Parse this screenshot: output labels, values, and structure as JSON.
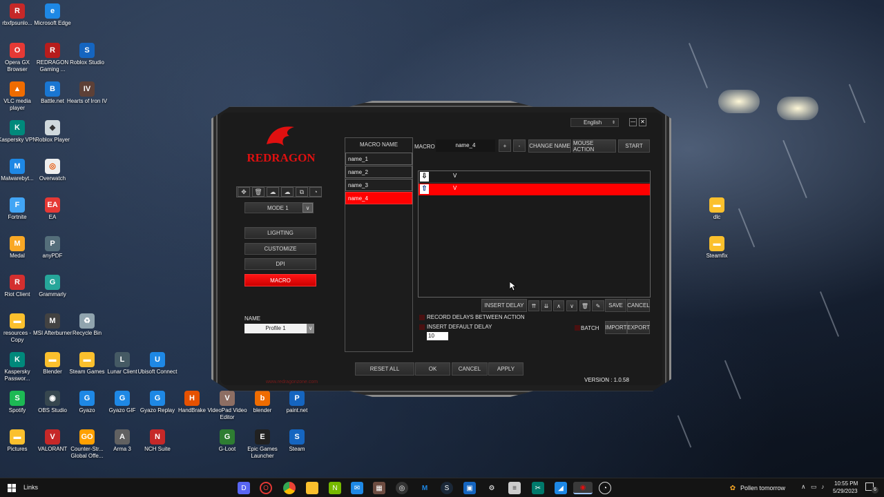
{
  "desktop": {
    "icons": [
      {
        "label": "rbxfpsunlo...",
        "color": "#c62828",
        "glyph": "R"
      },
      {
        "label": "Microsoft Edge",
        "color": "#1e88e5",
        "glyph": "e"
      },
      {
        "label": "Opera GX Browser",
        "color": "#e53935",
        "glyph": "O"
      },
      {
        "label": "REDRAGON Gaming ...",
        "color": "#b71c1c",
        "glyph": "R"
      },
      {
        "label": "Roblox Studio",
        "color": "#1565c0",
        "glyph": "S"
      },
      {
        "label": "VLC media player",
        "color": "#ef6c00",
        "glyph": "▲"
      },
      {
        "label": "Battle.net",
        "color": "#1976d2",
        "glyph": "B"
      },
      {
        "label": "Hearts of Iron IV",
        "color": "#5d4037",
        "glyph": "IV"
      },
      {
        "label": "Kaspersky VPN",
        "color": "#00897b",
        "glyph": "K"
      },
      {
        "label": "Roblox Player",
        "color": "#cfd8dc",
        "glyph": "◆"
      },
      {
        "label": "Malwarebyt...",
        "color": "#1e88e5",
        "glyph": "M"
      },
      {
        "label": "Overwatch",
        "color": "#eeeeee",
        "glyph": "◎"
      },
      {
        "label": "Fortnite",
        "color": "#42a5f5",
        "glyph": "F"
      },
      {
        "label": "EA",
        "color": "#e53935",
        "glyph": "EA"
      },
      {
        "label": "Medal",
        "color": "#f9a825",
        "glyph": "M"
      },
      {
        "label": "anyPDF",
        "color": "#546e7a",
        "glyph": "P"
      },
      {
        "label": "Riot Client",
        "color": "#d32f2f",
        "glyph": "R"
      },
      {
        "label": "Grammarly",
        "color": "#26a69a",
        "glyph": "G"
      },
      {
        "label": "resources - Copy",
        "color": "#fbc02d",
        "glyph": "▬"
      },
      {
        "label": "MSI Afterburner",
        "color": "#424242",
        "glyph": "M"
      },
      {
        "label": "Recycle Bin",
        "color": "#90a4ae",
        "glyph": "♻"
      },
      {
        "label": "Kaspersky Passwor...",
        "color": "#00897b",
        "glyph": "K"
      },
      {
        "label": "Blender",
        "color": "#fbc02d",
        "glyph": "▬"
      },
      {
        "label": "Steam Games",
        "color": "#fbc02d",
        "glyph": "▬"
      },
      {
        "label": "Lunar Client",
        "color": "#455a64",
        "glyph": "L"
      },
      {
        "label": "Ubisoft Connect",
        "color": "#1e88e5",
        "glyph": "U"
      },
      {
        "label": "Spotify",
        "color": "#1db954",
        "glyph": "S"
      },
      {
        "label": "OBS Studio",
        "color": "#37474f",
        "glyph": "◉"
      },
      {
        "label": "Gyazo",
        "color": "#1e88e5",
        "glyph": "G"
      },
      {
        "label": "Gyazo GIF",
        "color": "#1e88e5",
        "glyph": "G"
      },
      {
        "label": "Gyazo Replay",
        "color": "#1e88e5",
        "glyph": "G"
      },
      {
        "label": "HandBrake",
        "color": "#e65100",
        "glyph": "H"
      },
      {
        "label": "VideoPad Video Editor",
        "color": "#8d6e63",
        "glyph": "V"
      },
      {
        "label": "blender",
        "color": "#ef6c00",
        "glyph": "b"
      },
      {
        "label": "paint.net",
        "color": "#1565c0",
        "glyph": "P"
      },
      {
        "label": "Pictures",
        "color": "#fbc02d",
        "glyph": "▬"
      },
      {
        "label": "VALORANT",
        "color": "#c62828",
        "glyph": "V"
      },
      {
        "label": "Counter-Str... Global Offe...",
        "color": "#ffa000",
        "glyph": "GO"
      },
      {
        "label": "Arma 3",
        "color": "#616161",
        "glyph": "A"
      },
      {
        "label": "NCH Suite",
        "color": "#c62828",
        "glyph": "N"
      },
      {
        "label": "G-Loot",
        "color": "#2e7d32",
        "glyph": "G"
      },
      {
        "label": "Epic Games Launcher",
        "color": "#212121",
        "glyph": "E"
      },
      {
        "label": "Steam",
        "color": "#1565c0",
        "glyph": "S"
      },
      {
        "label": "dlc",
        "color": "#fbc02d",
        "glyph": "▬"
      },
      {
        "label": "Steamfix",
        "color": "#fbc02d",
        "glyph": "▬"
      }
    ]
  },
  "app": {
    "brand": "REDRAGON",
    "website": "www.redragonzone.com",
    "language": "English",
    "minimize": "—",
    "close": "✕",
    "mode_select": "MODE 1",
    "nav": [
      "LIGHTING",
      "CUSTOMIZE",
      "DPI",
      "MACRO"
    ],
    "profile_label": "NAME",
    "profile_value": "Profile 1",
    "macro_list_header": "MACRO NAME",
    "macros": [
      "name_1",
      "name_2",
      "name_3",
      "name_4"
    ],
    "macro_label": "MACRO",
    "macro_name_value": "name_4",
    "plus": "+",
    "minus": "-",
    "change_name": "CHANGE NAME",
    "mouse_action": "MOUSE ACTION",
    "start": "START",
    "events": [
      {
        "dir": "down",
        "key": "V"
      },
      {
        "dir": "up",
        "key": "V"
      }
    ],
    "insert_delay": "INSERT DELAY",
    "save": "SAVE",
    "cancel_small": "CANCEL",
    "record_delays": "RECORD DELAYS BETWEEN ACTION",
    "insert_default_delay": "INSERT DEFAULT DELAY",
    "delay_value": "10",
    "batch": "BATCH",
    "import": "IMPORT",
    "export": "EXPORT",
    "reset_all": "RESET ALL",
    "ok": "OK",
    "cancel": "CANCEL",
    "apply": "APPLY",
    "version": "VERSION : 1.0.58"
  },
  "taskbar": {
    "search": "Links",
    "weather": "Pollen tomorrow",
    "time": "10:55 PM",
    "date": "5/29/2023",
    "notif_count": "6"
  },
  "colors": {
    "accent": "#ff0000",
    "panel": "#1b1b1b"
  }
}
